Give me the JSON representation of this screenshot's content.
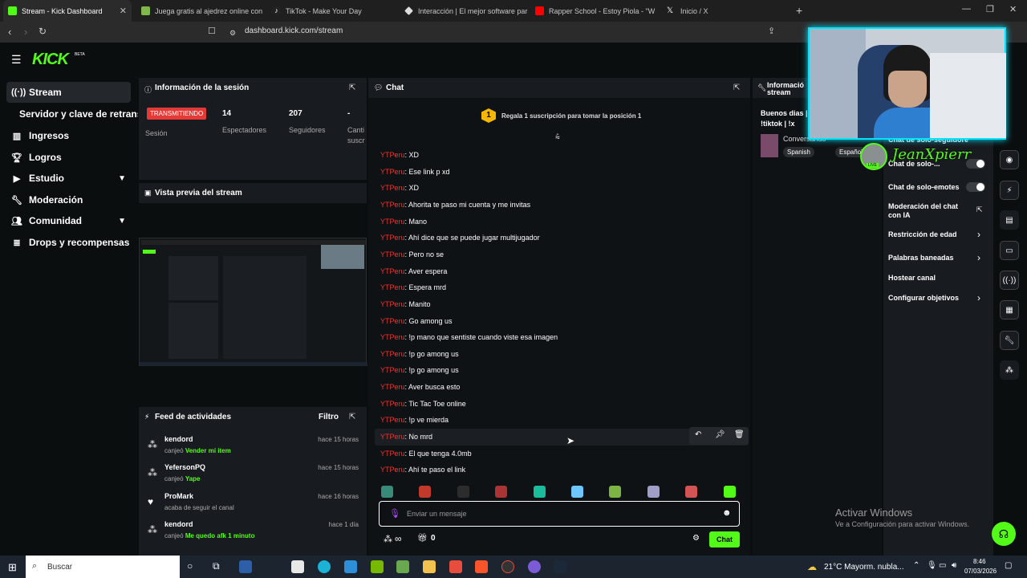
{
  "browser": {
    "tabs": [
      {
        "title": "Stream - Kick Dashboard",
        "color": "#53fc18"
      },
      {
        "title": "Juega gratis al ajedrez online con am",
        "color": "#81b64c"
      },
      {
        "title": "TikTok - Make Your Day",
        "color": "#ffffff"
      },
      {
        "title": "Interacción | El mejor software para p",
        "color": "#dddddd"
      },
      {
        "title": "Rapper School - Estoy Piola - \"W",
        "color": "#ff0000"
      },
      {
        "title": "Inicio / X",
        "color": "#ffffff"
      }
    ],
    "url": "dashboard.kick.com/stream"
  },
  "brand": {
    "logo": "KICK",
    "beta": "BETA",
    "accent": "#53fc18"
  },
  "sidebar": {
    "items": [
      {
        "label": "Stream",
        "icon": "stream-icon"
      },
      {
        "label": "Servidor y clave de retransmisión",
        "icon": ""
      },
      {
        "label": "Ingresos",
        "icon": "chart-icon"
      },
      {
        "label": "Logros",
        "icon": "trophy-icon"
      },
      {
        "label": "Estudio",
        "icon": "video-icon"
      },
      {
        "label": "Moderación",
        "icon": "wrench-icon"
      },
      {
        "label": "Comunidad",
        "icon": "people-icon"
      },
      {
        "label": "Drops y recompensas",
        "icon": "drops-icon"
      }
    ]
  },
  "session": {
    "title": "Información de la sesión",
    "status": "TRANSMITIENDO",
    "status_label": "Sesión",
    "viewers_value": "14",
    "viewers_label": "Espectadores",
    "followers_value": "207",
    "followers_label": "Seguidores",
    "subs_value": "-",
    "subs_label_1": "Canti",
    "subs_label_2": "suscr"
  },
  "preview": {
    "title": "Vista previa del stream"
  },
  "feed": {
    "title": "Feed de actividades",
    "filter": "Filtro",
    "items": [
      {
        "name": "kendord",
        "prefix": "canjeó",
        "highlight": "Vender mi item",
        "text": "",
        "time": "hace 15 horas",
        "icon": "redeem-icon"
      },
      {
        "name": "YefersonPQ",
        "prefix": "canjeó",
        "highlight": "Yape",
        "text": "",
        "time": "hace 15 horas",
        "icon": "redeem-icon"
      },
      {
        "name": "ProMark",
        "prefix": "",
        "highlight": "",
        "text": "acaba de seguir el canal",
        "time": "hace 16 horas",
        "icon": "heart-icon"
      },
      {
        "name": "kendord",
        "prefix": "canjeó",
        "highlight": "Me quedo afk 1 minuto",
        "text": "",
        "time": "hace 1 día",
        "icon": "redeem-icon"
      }
    ]
  },
  "chat": {
    "title": "Chat",
    "banner_badge": "1",
    "banner_text": "Regala 1 suscripción para tomar la posición 1",
    "username": "YTPeru",
    "messages": [
      "XD",
      "Ese link p xd",
      "XD",
      "Ahorita te paso mi cuenta y me invitas",
      "Mano",
      "Ahí dice que se puede jugar multijugador",
      "Pero no se",
      "Aver espera",
      "Espera mrd",
      "Manito",
      "Go among us",
      "!p mano que sentiste cuando viste esa imagen",
      "!p go among us",
      "!p go among us",
      "Aver busca esto",
      "Tic Tac Toe online",
      "!p ve mierda",
      "No mrd",
      "El que tenga 4.0mb",
      "Ahí te paso el link"
    ],
    "placeholder": "Enviar un mensaje",
    "points": "∞",
    "count": "0",
    "send_label": "Chat"
  },
  "stream_info": {
    "title_1": "Informació",
    "title_2": "stream",
    "stream_title_1": "Buenos dias |",
    "stream_title_2": "!tiktok | !x",
    "category": "Conversando",
    "tag_1": "Spanish",
    "tag_2": "Español"
  },
  "webcam": {
    "overlay_name": "JeanXpierr",
    "live_badge": "LIVE"
  },
  "chat_settings": {
    "followers_only": "Chat de solo-seguidore",
    "subs_only": "Chat de solo-...",
    "emotes_only": "Chat de solo-emotes",
    "ai_mod_1": "Moderación del chat",
    "ai_mod_2": "con IA",
    "age": "Restricción de edad",
    "banned_words": "Palabras baneadas",
    "host": "Hostear canal",
    "goals": "Configurar objetivos"
  },
  "windows_activation": {
    "title": "Activar Windows",
    "subtitle": "Ve a Configuración para activar Windows."
  },
  "taskbar": {
    "search": "Buscar",
    "weather": "21°C  Mayorm. nubla...",
    "time": "8:46",
    "date": "07/03/2026"
  }
}
